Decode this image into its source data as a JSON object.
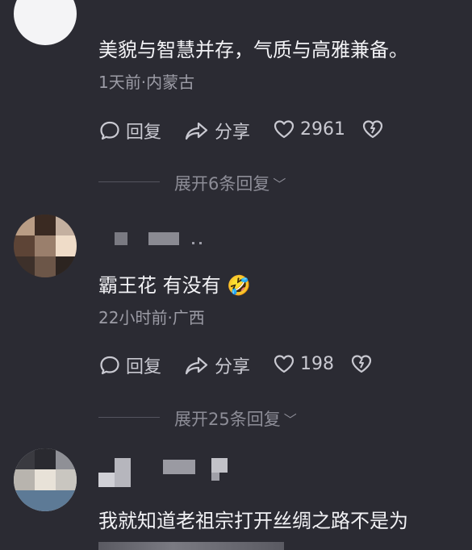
{
  "comments": [
    {
      "text": "美貌与智慧并存，气质与高雅兼备。",
      "meta": "1天前·内蒙古",
      "reply_label": "回复",
      "share_label": "分享",
      "likes": "2961",
      "expand_label": "展开6条回复"
    },
    {
      "text": "霸王花 有没有",
      "emoji": "🤣",
      "meta": "22小时前·广西",
      "reply_label": "回复",
      "share_label": "分享",
      "likes": "198",
      "expand_label": "展开25条回复"
    },
    {
      "text": "我就知道老祖宗打开丝绸之路不是为"
    }
  ],
  "colors": {
    "background": "#2b2b33",
    "text": "#f2f2f5",
    "meta": "#9c9ca6"
  }
}
